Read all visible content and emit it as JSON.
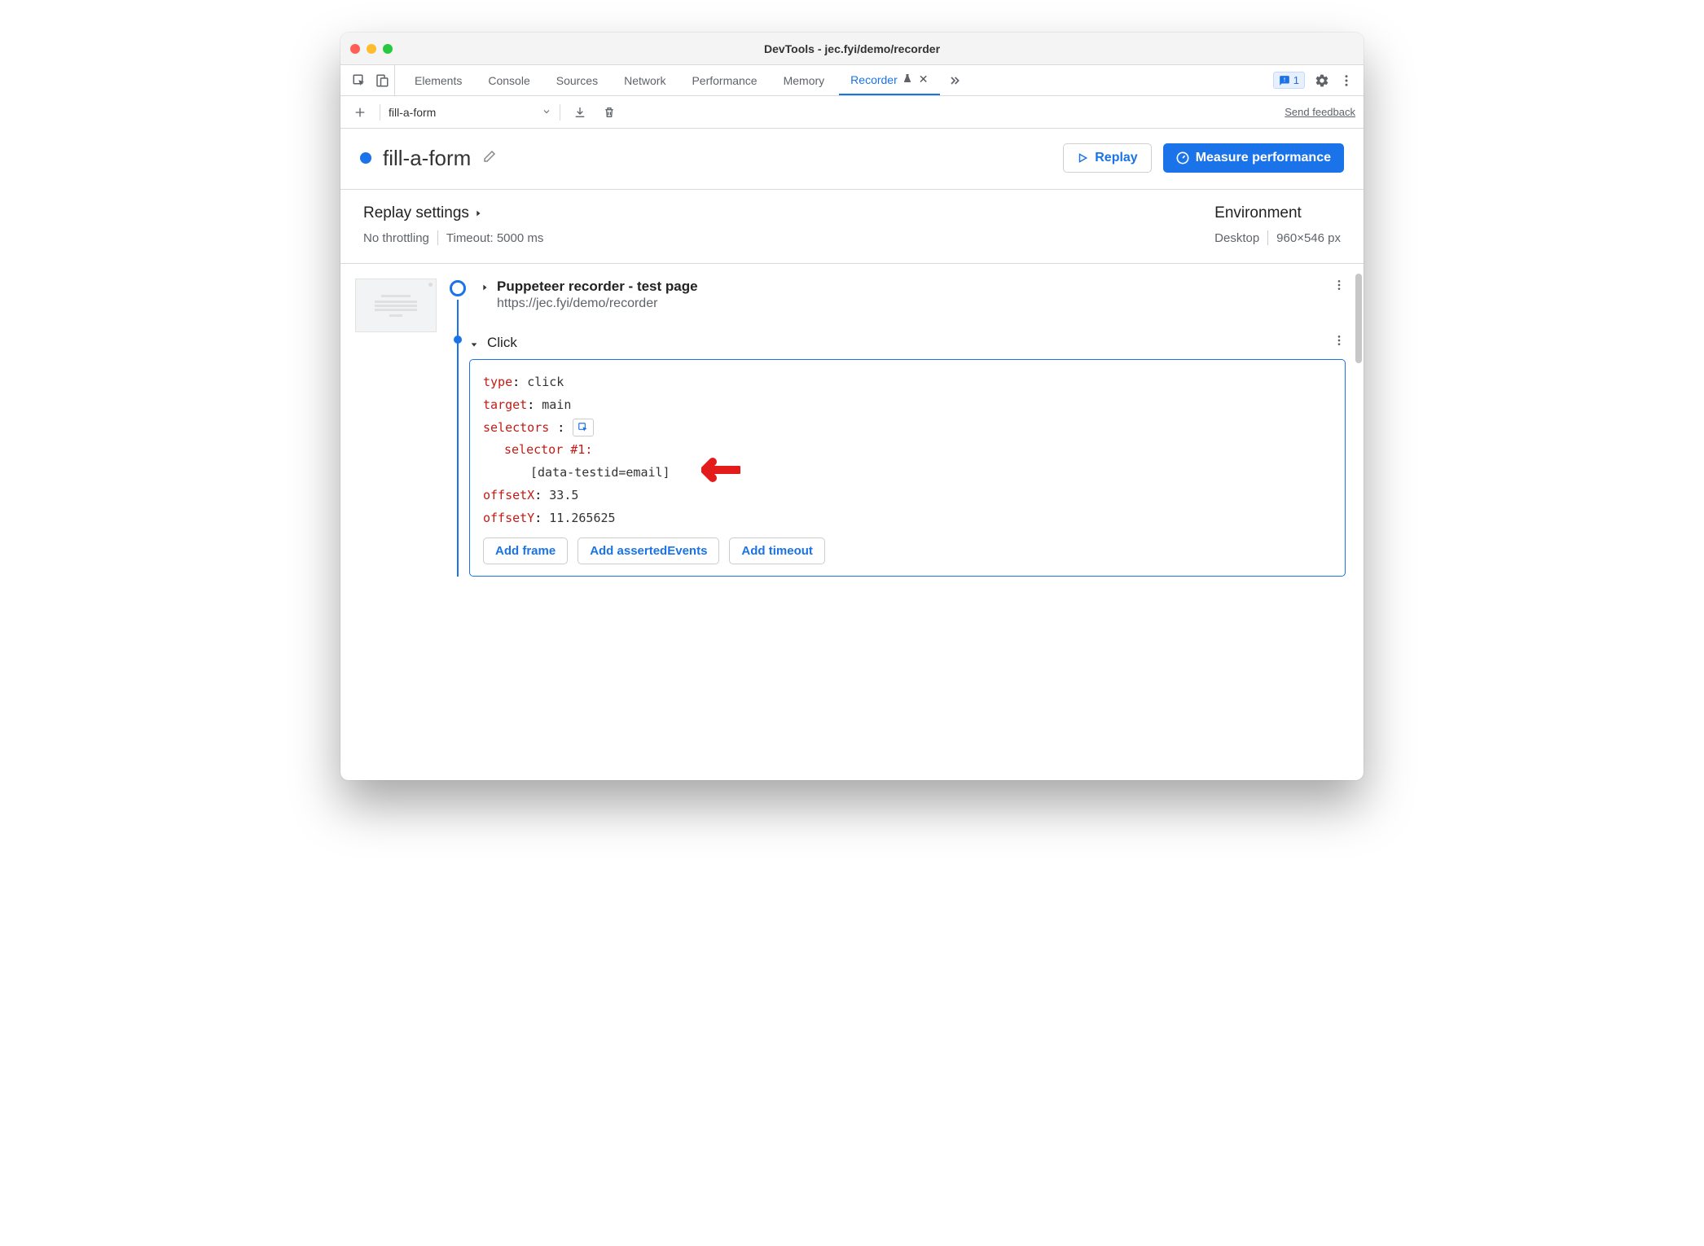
{
  "window": {
    "title": "DevTools - jec.fyi/demo/recorder"
  },
  "tabs": {
    "items": [
      "Elements",
      "Console",
      "Sources",
      "Network",
      "Performance",
      "Memory"
    ],
    "active": "Recorder",
    "issues_count": "1"
  },
  "toolbar": {
    "recording_name": "fill-a-form",
    "send_feedback": "Send feedback"
  },
  "header": {
    "name": "fill-a-form",
    "replay": "Replay",
    "measure": "Measure performance"
  },
  "settings": {
    "replay_title": "Replay settings",
    "throttling": "No throttling",
    "timeout": "Timeout: 5000 ms",
    "env_title": "Environment",
    "device": "Desktop",
    "viewport": "960×546 px"
  },
  "steps": {
    "first": {
      "title": "Puppeteer recorder - test page",
      "url": "https://jec.fyi/demo/recorder"
    },
    "click": {
      "label": "Click",
      "type_key": "type",
      "type_val": "click",
      "target_key": "target",
      "target_val": "main",
      "selectors_key": "selectors",
      "selector_label": "selector #1",
      "selector_val": "[data-testid=email]",
      "offsetx_key": "offsetX",
      "offsetx_val": "33.5",
      "offsety_key": "offsetY",
      "offsety_val": "11.265625",
      "add_frame": "Add frame",
      "add_asserted": "Add assertedEvents",
      "add_timeout": "Add timeout"
    }
  }
}
